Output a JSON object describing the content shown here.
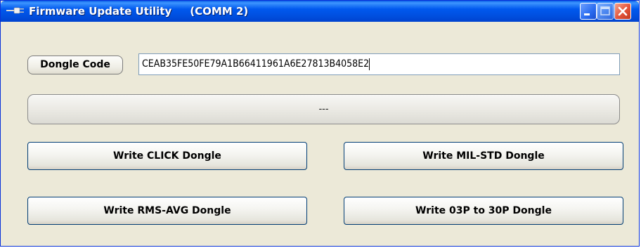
{
  "window": {
    "title": "Firmware Update Utility",
    "port": "(COMM 2)",
    "icon": "plug-icon",
    "controls": {
      "minimize_icon": "minimize-icon",
      "maximize_icon": "maximize-icon",
      "close_icon": "close-icon"
    }
  },
  "dongle": {
    "label": "Dongle Code",
    "value": "CEAB35FE50FE79A1B66411961A6E27813B4058E2"
  },
  "status": {
    "text": "---"
  },
  "buttons": {
    "write_click": "Write CLICK Dongle",
    "write_mil_std": "Write MIL-STD Dongle",
    "write_rms_avg": "Write RMS-AVG Dongle",
    "write_03p_30p": "Write 03P to 30P Dongle"
  },
  "colors": {
    "titlebar": "#0058ee",
    "window_bg": "#ece9d8",
    "close_button": "#e2533a",
    "button_border": "#003c74"
  }
}
